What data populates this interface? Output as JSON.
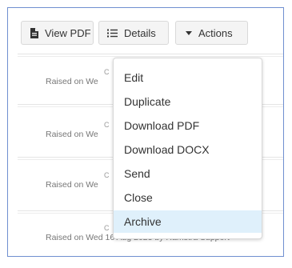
{
  "toolbar": {
    "view_pdf": {
      "label": "View PDF",
      "icon": "document-icon"
    },
    "details": {
      "label": "Details",
      "icon": "list-icon"
    },
    "actions": {
      "label": "Actions",
      "icon": "caret-down-icon"
    }
  },
  "rows": [
    {
      "top_fragment": "C",
      "text": "Raised on We"
    },
    {
      "top_fragment": "C",
      "text": "Raised on We"
    },
    {
      "top_fragment": "C",
      "text": "Raised on We"
    },
    {
      "top_fragment": "C",
      "text": "Raised on Wed 16 Aug 2023 by Ramstra Support"
    }
  ],
  "menu": {
    "items": [
      "Edit",
      "Duplicate",
      "Download PDF",
      "Download DOCX",
      "Send",
      "Close",
      "Archive"
    ],
    "active_index": 6,
    "active_color": "#dff0fb"
  },
  "colors": {
    "frame_border": "#6f8fd0",
    "button_bg": "#f4f4f4"
  }
}
